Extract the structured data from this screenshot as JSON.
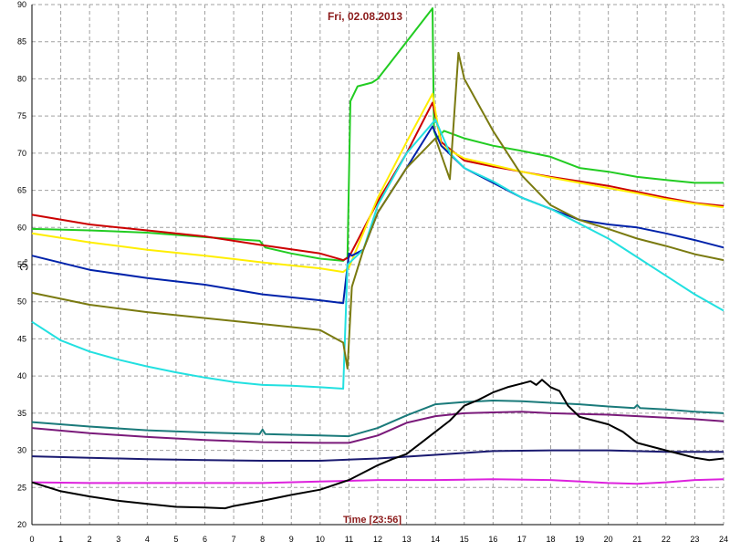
{
  "chart_data": {
    "type": "line",
    "title": "Fri, 02.08.2013",
    "xlabel": "Time [23:56]",
    "ylabel": "°C",
    "xlim": [
      0,
      24
    ],
    "ylim": [
      20,
      90
    ],
    "x_ticks": [
      0,
      1,
      2,
      3,
      4,
      5,
      6,
      7,
      8,
      9,
      10,
      11,
      12,
      13,
      14,
      15,
      16,
      17,
      18,
      19,
      20,
      21,
      22,
      23,
      24
    ],
    "y_ticks": [
      20,
      25,
      30,
      35,
      40,
      45,
      50,
      55,
      60,
      65,
      70,
      75,
      80,
      85,
      90
    ],
    "grid": true,
    "series": [
      {
        "color": "#22cc22",
        "x": [
          0,
          2,
          4,
          6,
          7.9,
          8.1,
          9,
          10,
          10.8,
          10.95,
          11.05,
          11.3,
          11.8,
          12,
          13,
          13.9,
          13.95,
          14.05,
          14.3,
          15,
          16,
          17,
          18,
          19,
          20,
          21,
          22,
          23,
          24
        ],
        "y": [
          59.8,
          59.6,
          59.3,
          58.7,
          58.2,
          57.3,
          56.5,
          55.8,
          55.5,
          56,
          77,
          79,
          79.5,
          80,
          85,
          89.5,
          73,
          72,
          73,
          72,
          71,
          70.3,
          69.5,
          68,
          67.5,
          66.8,
          66.4,
          66,
          66
        ]
      },
      {
        "color": "#cc0000",
        "x": [
          0,
          2,
          4,
          6,
          8,
          10,
          10.8,
          11,
          12,
          13,
          13.9,
          14.2,
          15,
          16,
          17,
          18,
          19,
          20,
          21,
          22,
          23,
          24
        ],
        "y": [
          61.7,
          60.4,
          59.6,
          58.8,
          57.6,
          56.5,
          55.6,
          56,
          63.5,
          70,
          76.8,
          71.5,
          69,
          68.2,
          67.5,
          66.8,
          66.2,
          65.6,
          64.8,
          64,
          63.3,
          62.9
        ]
      },
      {
        "color": "#ffee00",
        "x": [
          0,
          2,
          4,
          6,
          8,
          10,
          10.8,
          11,
          12,
          13,
          13.9,
          14.2,
          15,
          16,
          17,
          18,
          19,
          20,
          21,
          22,
          23,
          24
        ],
        "y": [
          59.2,
          58,
          57,
          56.2,
          55.3,
          54.5,
          54,
          54.6,
          64,
          71.5,
          78,
          71,
          69.3,
          68.4,
          67.5,
          66.7,
          66,
          65.3,
          64.6,
          63.8,
          63.2,
          62.7
        ]
      },
      {
        "color": "#0022aa",
        "x": [
          0,
          2,
          4,
          6,
          8,
          10,
          10.8,
          11,
          11.1,
          11.5,
          12,
          13,
          13.9,
          14.2,
          15,
          16,
          17,
          18,
          19,
          20,
          21,
          22,
          23,
          24
        ],
        "y": [
          56.2,
          54.3,
          53.2,
          52.3,
          51,
          50.2,
          49.8,
          56.5,
          56.2,
          57,
          62,
          68,
          73.6,
          71,
          68,
          66,
          64,
          62.5,
          61,
          60.4,
          60,
          59.2,
          58.3,
          57.3
        ]
      },
      {
        "color": "#22e0e0",
        "x": [
          0,
          1,
          2,
          3,
          4,
          5,
          6,
          7,
          8,
          9,
          10,
          10.8,
          10.95,
          11.5,
          12,
          13,
          14,
          14.5,
          15,
          16,
          17,
          18,
          19,
          20,
          21,
          22,
          23,
          24
        ],
        "y": [
          47.3,
          44.8,
          43.3,
          42.2,
          41.3,
          40.5,
          39.8,
          39.2,
          38.8,
          38.7,
          38.5,
          38.3,
          55,
          57,
          63,
          70,
          74.5,
          70,
          68,
          66.2,
          64,
          62.5,
          60.5,
          58.5,
          56,
          53.5,
          51,
          48.8
        ]
      },
      {
        "color": "#7a7a10",
        "x": [
          0,
          2,
          4,
          6,
          8,
          10,
          10.8,
          10.95,
          11.1,
          11.5,
          12,
          13,
          14,
          14.5,
          14.8,
          15,
          16,
          17,
          18,
          19,
          20,
          21,
          22,
          23,
          24
        ],
        "y": [
          51.2,
          49.6,
          48.6,
          47.8,
          47,
          46.2,
          44.5,
          41,
          52,
          57,
          62,
          68,
          72,
          66.5,
          83.5,
          80,
          73,
          67,
          63,
          61,
          59.8,
          58.5,
          57.5,
          56.4,
          55.6
        ]
      },
      {
        "color": "#1a7a7a",
        "x": [
          0,
          2,
          4,
          6,
          7.9,
          8,
          8.1,
          9,
          10,
          11,
          12,
          13,
          14,
          15,
          16,
          17,
          18,
          19,
          20,
          20.9,
          21,
          21.1,
          22,
          23,
          24
        ],
        "y": [
          33.8,
          33.2,
          32.7,
          32.4,
          32.2,
          32.8,
          32.2,
          32.1,
          32,
          31.9,
          33,
          34.7,
          36.2,
          36.5,
          36.7,
          36.6,
          36.4,
          36.2,
          35.9,
          35.7,
          36.1,
          35.7,
          35.5,
          35.2,
          35
        ]
      },
      {
        "color": "#7a1a7a",
        "x": [
          0,
          2,
          4,
          6,
          8,
          10,
          11,
          12,
          13,
          14,
          15,
          16,
          17,
          18,
          19,
          20,
          21,
          22,
          23,
          24
        ],
        "y": [
          33,
          32.3,
          31.8,
          31.4,
          31.1,
          31,
          31,
          32,
          33.7,
          34.6,
          35,
          35.1,
          35.2,
          35,
          34.9,
          34.8,
          34.6,
          34.4,
          34.2,
          33.9
        ]
      },
      {
        "color": "#1a1a70",
        "x": [
          0,
          2,
          4,
          6,
          8,
          10,
          12,
          14,
          16,
          18,
          20,
          22,
          24
        ],
        "y": [
          29.2,
          29,
          28.8,
          28.7,
          28.6,
          28.6,
          28.9,
          29.4,
          29.9,
          30,
          30,
          29.8,
          29.8
        ]
      },
      {
        "color": "#dd22dd",
        "x": [
          0,
          2,
          4,
          6,
          8,
          10,
          12,
          14,
          16,
          18,
          20,
          21,
          22,
          23,
          24
        ],
        "y": [
          25.7,
          25.6,
          25.6,
          25.6,
          25.6,
          25.8,
          26,
          26,
          26.1,
          26,
          25.6,
          25.5,
          25.7,
          26,
          26.1
        ]
      },
      {
        "color": "#000000",
        "x": [
          0,
          1,
          2,
          3,
          4,
          5,
          6,
          6.7,
          7,
          8,
          9,
          10,
          11,
          11.5,
          12,
          12.5,
          13,
          13.5,
          14,
          14.5,
          15,
          15.5,
          16,
          16.5,
          17,
          17.3,
          17.5,
          17.7,
          18,
          18.3,
          18.6,
          19,
          19.5,
          20,
          20.5,
          21,
          21.5,
          22,
          22.5,
          23,
          23.5,
          24
        ],
        "y": [
          25.7,
          24.5,
          23.8,
          23.2,
          22.8,
          22.4,
          22.3,
          22.2,
          22.5,
          23.2,
          24,
          24.7,
          26,
          27,
          28,
          28.8,
          29.5,
          31,
          32.5,
          34,
          36,
          36.8,
          37.8,
          38.5,
          39,
          39.3,
          38.8,
          39.5,
          38.5,
          38,
          36,
          34.5,
          34,
          33.5,
          32.5,
          31,
          30.5,
          30,
          29.5,
          29,
          28.7,
          28.9
        ]
      }
    ]
  }
}
